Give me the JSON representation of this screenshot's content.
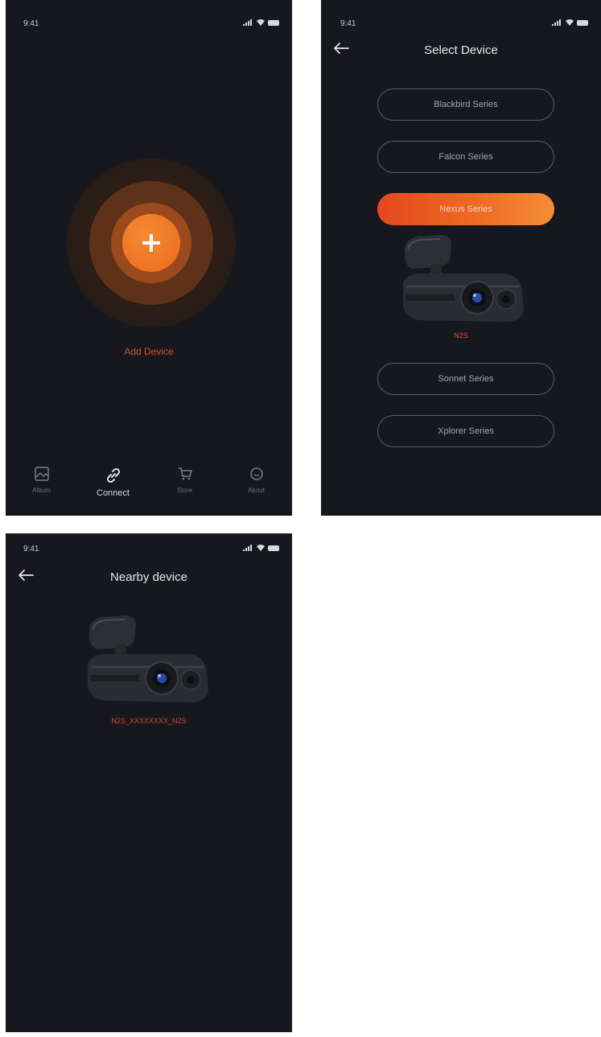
{
  "status": {
    "time": "9:41"
  },
  "home": {
    "add_label": "Add Device",
    "tabs": [
      {
        "label": "Album",
        "icon": "album-icon"
      },
      {
        "label": "Connect",
        "icon": "link-icon"
      },
      {
        "label": "Store",
        "icon": "cart-icon"
      },
      {
        "label": "About",
        "icon": "chat-icon"
      }
    ]
  },
  "select_device": {
    "title": "Select Device",
    "series": [
      {
        "label": "Blackbird Series",
        "active": false
      },
      {
        "label": "Falcon Series",
        "active": false
      },
      {
        "label": "Nexus Series",
        "active": true
      },
      {
        "label": "Sonnet Series",
        "active": false
      },
      {
        "label": "Xplorer Series",
        "active": false
      }
    ],
    "model_label": "N2S"
  },
  "nearby": {
    "title": "Nearby device",
    "device_name": "N2S_XXXXXXXX_N2S"
  },
  "colors": {
    "background": "#17181d",
    "accent_orange": "#ee6a23",
    "accent_red": "#d4502a"
  }
}
